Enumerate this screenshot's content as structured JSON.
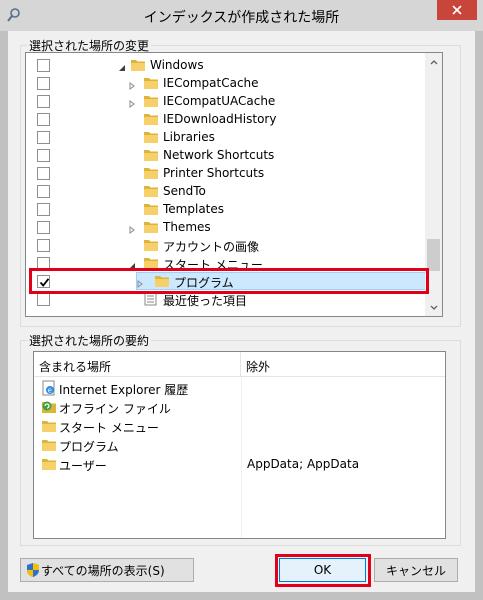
{
  "window": {
    "title": "インデックスが作成された場所"
  },
  "tree_group": {
    "label": "選択された場所の変更"
  },
  "tree": {
    "rows": [
      {
        "label": "Windows",
        "checked": false,
        "expander": "expanded",
        "indent": 1
      },
      {
        "label": "IECompatCache",
        "checked": false,
        "expander": "collapsed",
        "indent": 2
      },
      {
        "label": "IECompatUACache",
        "checked": false,
        "expander": "collapsed",
        "indent": 2
      },
      {
        "label": "IEDownloadHistory",
        "checked": false,
        "expander": "none",
        "indent": 2
      },
      {
        "label": "Libraries",
        "checked": false,
        "expander": "none",
        "indent": 2
      },
      {
        "label": "Network Shortcuts",
        "checked": false,
        "expander": "none",
        "indent": 2
      },
      {
        "label": "Printer Shortcuts",
        "checked": false,
        "expander": "none",
        "indent": 2
      },
      {
        "label": "SendTo",
        "checked": false,
        "expander": "none",
        "indent": 2
      },
      {
        "label": "Templates",
        "checked": false,
        "expander": "none",
        "indent": 2
      },
      {
        "label": "Themes",
        "checked": false,
        "expander": "collapsed",
        "indent": 2
      },
      {
        "label": "アカウントの画像",
        "checked": false,
        "expander": "none",
        "indent": 2
      },
      {
        "label": "スタート メニュー",
        "checked": false,
        "expander": "expanded",
        "indent": 2
      },
      {
        "label": "プログラム",
        "checked": true,
        "expander": "collapsed",
        "indent": 3,
        "selected": true
      },
      {
        "label": "最近使った項目",
        "checked": false,
        "expander": "none",
        "indent": 2
      }
    ]
  },
  "summary_group": {
    "label": "選択された場所の要約"
  },
  "summary": {
    "headers": {
      "included": "含まれる場所",
      "excluded": "除外"
    },
    "rows": [
      {
        "icon": "internet-explorer-icon",
        "name": "Internet Explorer 履歴",
        "excluded": ""
      },
      {
        "icon": "offline-files-icon",
        "name": "オフライン ファイル",
        "excluded": ""
      },
      {
        "icon": "folder-icon",
        "name": "スタート メニュー",
        "excluded": ""
      },
      {
        "icon": "folder-icon",
        "name": "プログラム",
        "excluded": ""
      },
      {
        "icon": "folder-icon",
        "name": "ユーザー",
        "excluded": "AppData; AppData"
      }
    ]
  },
  "buttons": {
    "show_all": "すべての場所の表示(S)",
    "ok": "OK",
    "cancel": "キャンセル"
  },
  "colors": {
    "highlight": "#e0001a",
    "selection": "#cce8ff",
    "close": "#c7453a"
  }
}
